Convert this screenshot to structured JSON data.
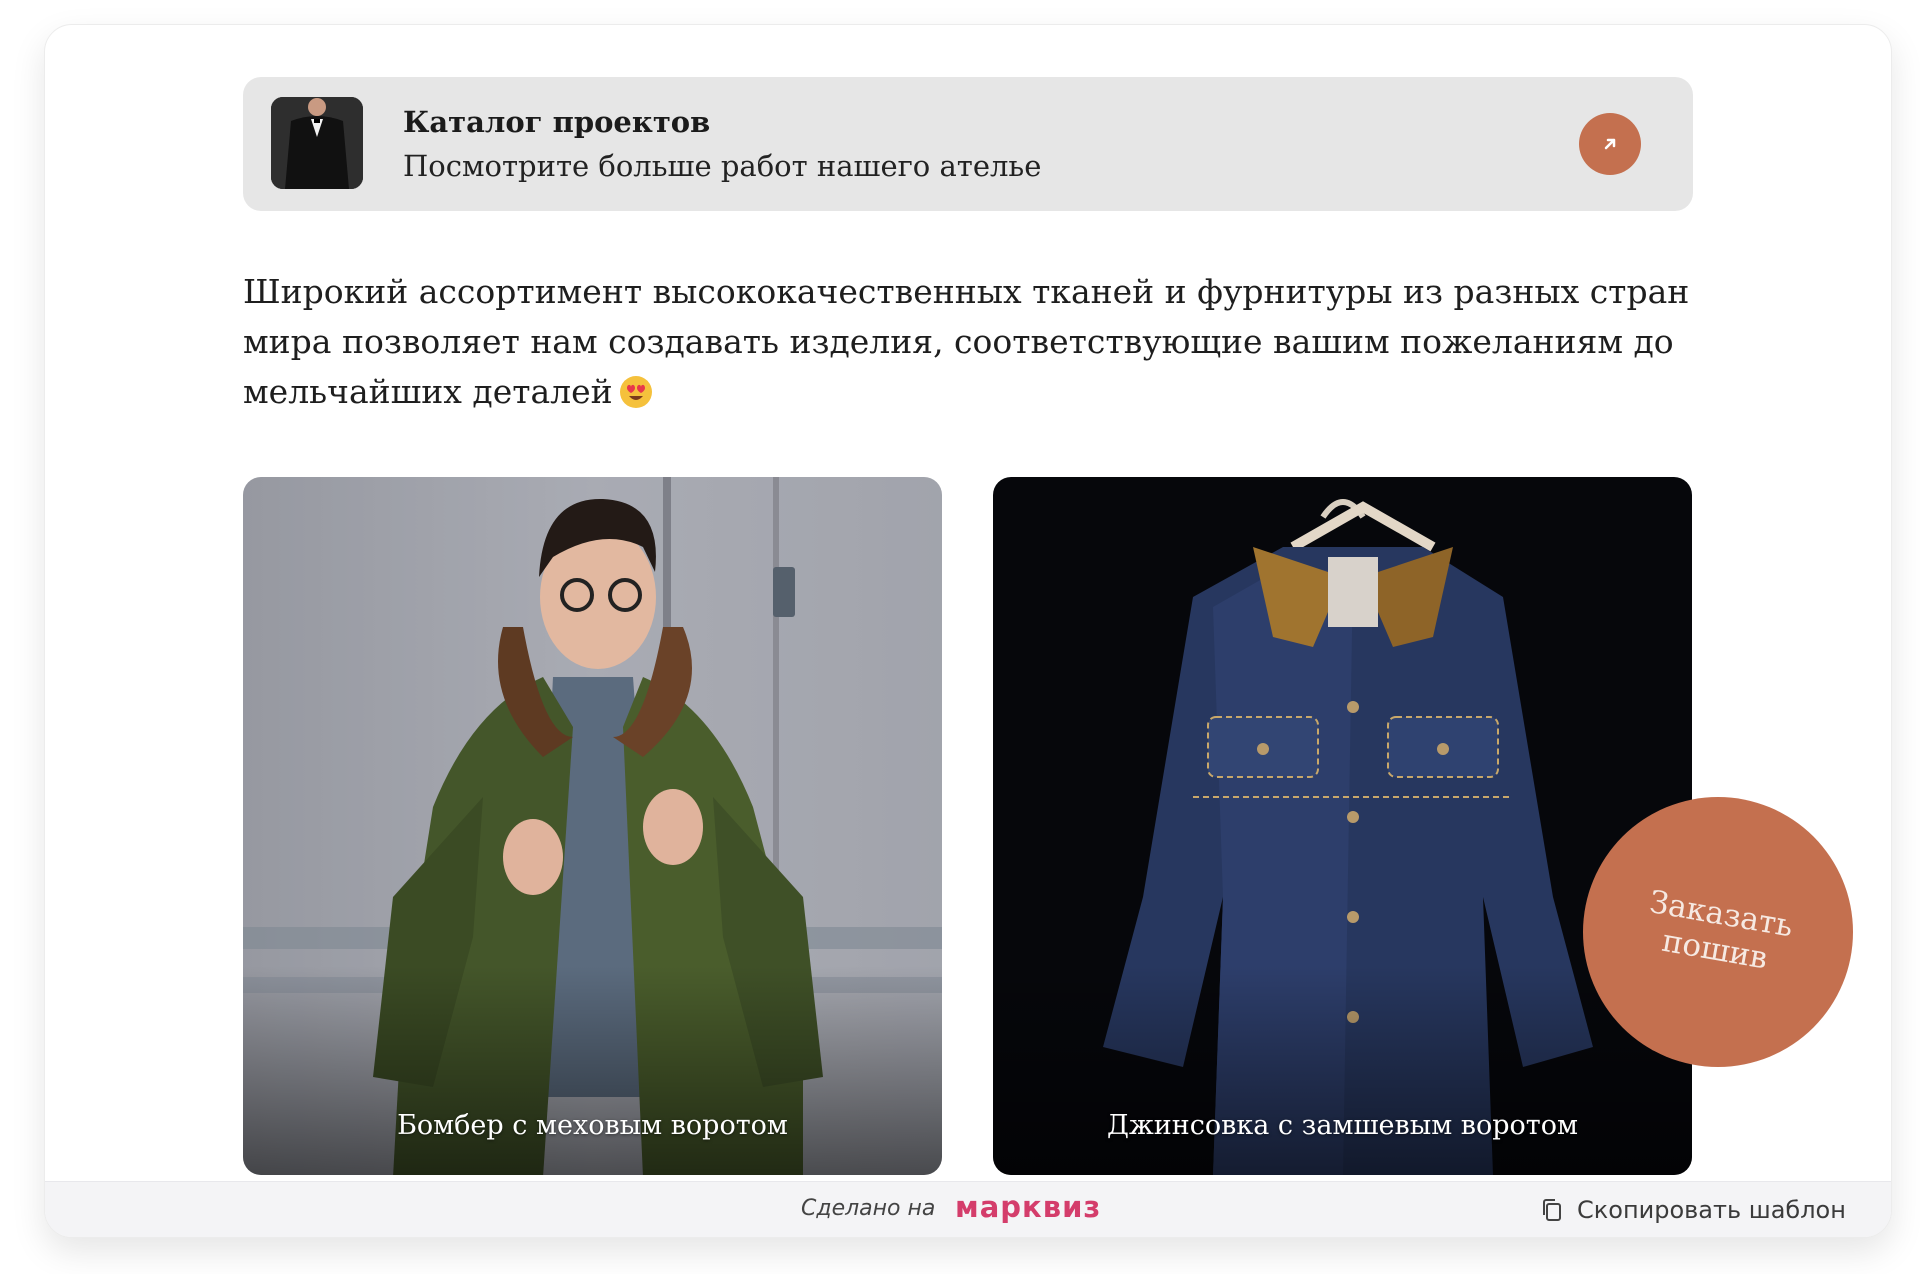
{
  "catalog": {
    "title": "Каталог проектов",
    "subtitle": "Посмотрите больше работ нашего ателье",
    "thumb_icon": "suit-photo",
    "action_icon": "arrow-up-right-icon"
  },
  "description": "Широкий ассортимент высококачественных тканей и фурнитуры из разных стран мира позволяет нам создавать изделия, соответствующие вашим пожеланиям до мельчайших деталей",
  "description_emoji": "heart-eyes-emoji",
  "gallery": [
    {
      "caption": "Бомбер с меховым воротом"
    },
    {
      "caption": "Джинсовка с замшевым воротом"
    }
  ],
  "order_button": {
    "label": "Заказать пошив"
  },
  "footer": {
    "made_on": "Сделано на",
    "brand": "марквиз",
    "copy_label": "Скопировать шаблон",
    "copy_icon": "copy-icon"
  },
  "colors": {
    "accent": "#c4704f",
    "brand": "#d43d6b",
    "catalog_bg": "#e6e6e6"
  }
}
